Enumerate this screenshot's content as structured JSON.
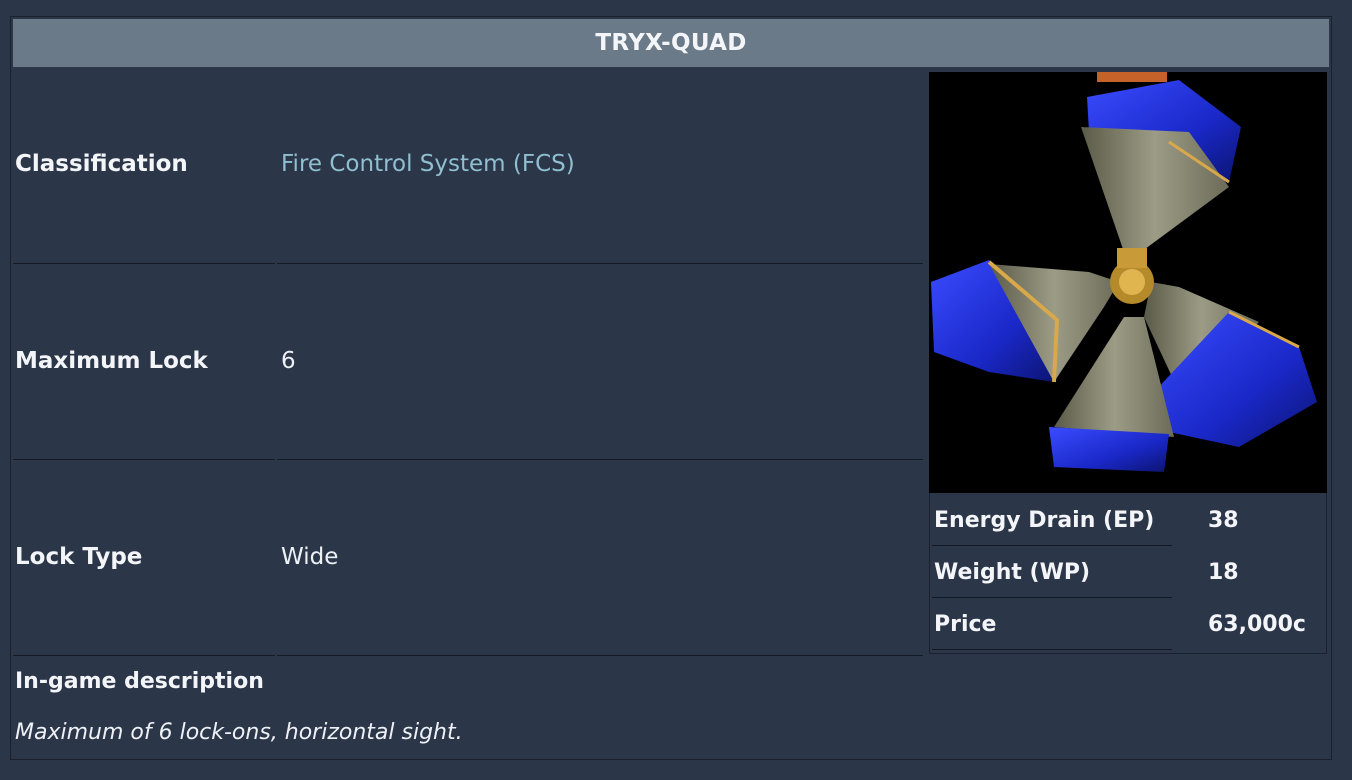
{
  "infobox": {
    "title": "TRYX-QUAD",
    "rows": [
      {
        "label": "Classification",
        "value": "Fire Control System (FCS)"
      },
      {
        "label": "Maximum Lock",
        "value": "6"
      },
      {
        "label": "Lock Type",
        "value": "Wide"
      }
    ],
    "stats": [
      {
        "label": "Energy Drain (EP)",
        "value": "38"
      },
      {
        "label": "Weight (WP)",
        "value": "18"
      },
      {
        "label": "Price",
        "value": "63,000c"
      }
    ],
    "description": {
      "heading": "In-game description",
      "text": "Maximum of 6 lock-ons, horizontal sight."
    }
  },
  "colors": {
    "background": "#2b3649",
    "title_bar": "#6a7a89",
    "link": "#8fbfd0"
  }
}
